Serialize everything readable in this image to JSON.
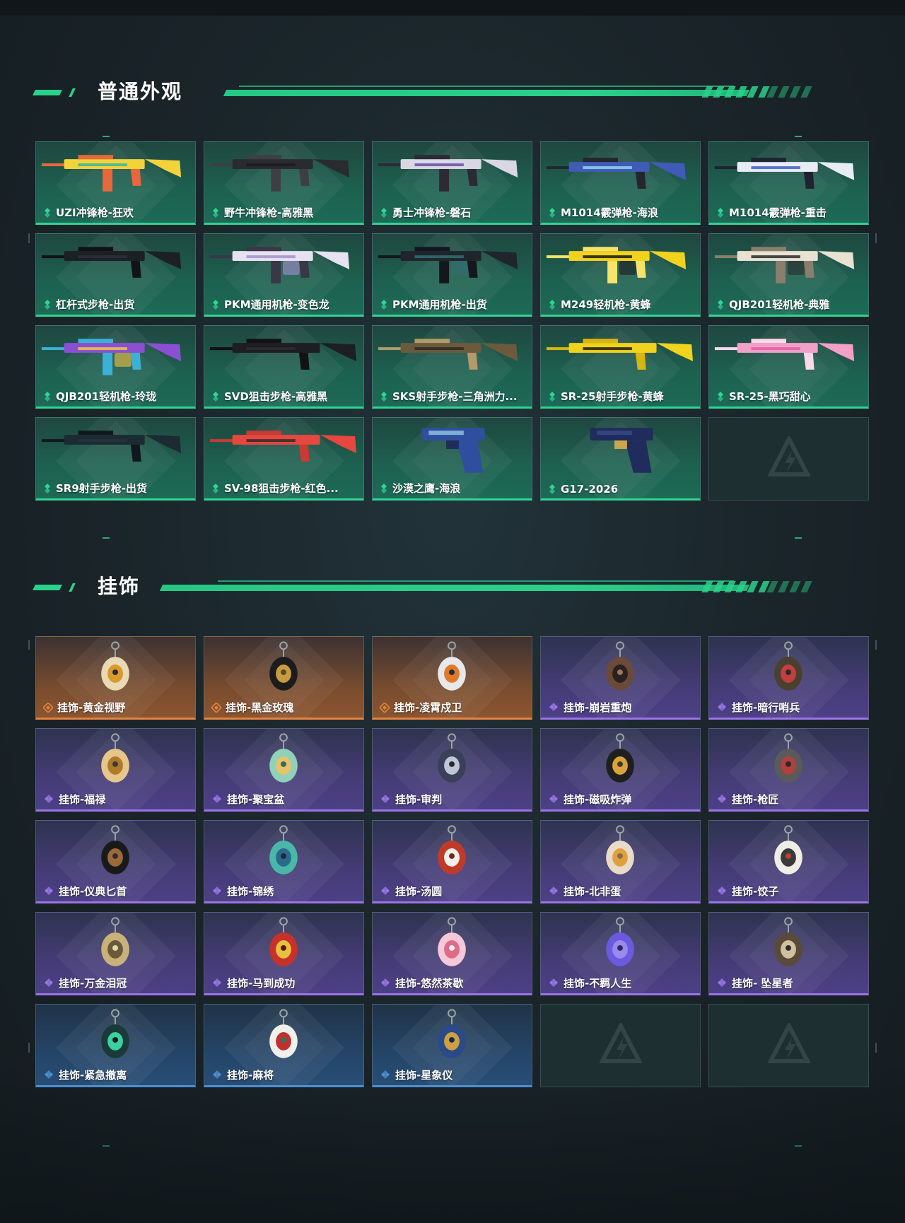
{
  "sections": [
    {
      "title": "普通外观",
      "rarity_color": "#2fd592",
      "items": [
        {
          "label": "UZI冲锋枪-狂欢",
          "kind": "smg",
          "colors": [
            "#f3d23a",
            "#39b6a2",
            "#e8683a"
          ]
        },
        {
          "label": "野牛冲锋枪-高雅黑",
          "kind": "smg",
          "colors": [
            "#2a2b2e",
            "#1b1c1e",
            "#3e3f43"
          ]
        },
        {
          "label": "勇士冲锋枪-磐石",
          "kind": "smg",
          "colors": [
            "#d9d7e4",
            "#6b4fa3",
            "#2c2a33"
          ]
        },
        {
          "label": "M1014霰弹枪-海浪",
          "kind": "shotgun",
          "colors": [
            "#3f5bb5",
            "#8fd5ef",
            "#23262d"
          ]
        },
        {
          "label": "M1014霰弹枪-重击",
          "kind": "shotgun",
          "colors": [
            "#e8ecf5",
            "#3e5fc2",
            "#1f2330"
          ]
        },
        {
          "label": "杠杆式步枪-出货",
          "kind": "rifle",
          "colors": [
            "#1c1f24",
            "#2b3038",
            "#111316"
          ]
        },
        {
          "label": "PKM通用机枪-变色龙",
          "kind": "lmg",
          "colors": [
            "#e6e2ef",
            "#a491d1",
            "#3a3747"
          ]
        },
        {
          "label": "PKM通用机枪-出货",
          "kind": "lmg",
          "colors": [
            "#20242b",
            "#2f6f74",
            "#14171b"
          ]
        },
        {
          "label": "M249轻机枪-黄蜂",
          "kind": "lmg",
          "colors": [
            "#f1d21d",
            "#1a1a1a",
            "#f6e36a"
          ]
        },
        {
          "label": "QJB201轻机枪-典雅",
          "kind": "lmg",
          "colors": [
            "#e9e2d3",
            "#2a2a2d",
            "#8a7f6c"
          ]
        },
        {
          "label": "QJB201轻机枪-玲珑",
          "kind": "lmg",
          "colors": [
            "#8b4fd3",
            "#f0c541",
            "#3bb1d8"
          ]
        },
        {
          "label": "SVD狙击步枪-高雅黑",
          "kind": "sniper",
          "colors": [
            "#1d1e21",
            "#2c2d31",
            "#111214"
          ]
        },
        {
          "label": "SKS射手步枪-三角洲力...",
          "kind": "rifle",
          "colors": [
            "#6b5a3b",
            "#2c2a25",
            "#b29b6a"
          ]
        },
        {
          "label": "SR-25射手步枪-黄蜂",
          "kind": "sniper",
          "colors": [
            "#f1d21d",
            "#1b1b1b",
            "#d9b50f"
          ]
        },
        {
          "label": "SR-25-黑巧甜心",
          "kind": "rifle",
          "colors": [
            "#f2a0c8",
            "#e35fa2",
            "#f9d9ea"
          ]
        },
        {
          "label": "SR9射手步枪-出货",
          "kind": "rifle",
          "colors": [
            "#1b2a33",
            "#24353f",
            "#10181d"
          ]
        },
        {
          "label": "SV-98狙击步枪-红色...",
          "kind": "sniper",
          "colors": [
            "#e6473e",
            "#2b2b2e",
            "#c83a32"
          ]
        },
        {
          "label": "沙漠之鹰-海浪",
          "kind": "pistol",
          "colors": [
            "#2f4f9e",
            "#9fd8f1",
            "#1e2d59"
          ]
        },
        {
          "label": "G17-2026",
          "kind": "pistol",
          "colors": [
            "#1f2c5c",
            "#3c4f8e",
            "#c9a74b"
          ]
        },
        {
          "label": "",
          "kind": "empty",
          "colors": []
        }
      ]
    },
    {
      "title": "挂饰",
      "items": [
        {
          "label": "挂饰-黄金视野",
          "rarity": "orange",
          "colors": [
            "#e9d9b4",
            "#d99a2a",
            "#2a2a2a"
          ]
        },
        {
          "label": "挂饰-黑金玫瑰",
          "rarity": "orange",
          "colors": [
            "#1c1c1c",
            "#c89b3c",
            "#5a4a2a"
          ]
        },
        {
          "label": "挂饰-凌霄戍卫",
          "rarity": "orange",
          "colors": [
            "#e8e8ea",
            "#e07a2a",
            "#2b2b2b"
          ]
        },
        {
          "label": "挂饰-崩岩重炮",
          "rarity": "purple",
          "colors": [
            "#6b4a3a",
            "#2a2020",
            "#9a7a5a"
          ]
        },
        {
          "label": "挂饰-暗行哨兵",
          "rarity": "purple",
          "colors": [
            "#4a4030",
            "#c04040",
            "#2a2a2a"
          ]
        },
        {
          "label": "挂饰-福禄",
          "rarity": "purple",
          "colors": [
            "#e6c68a",
            "#b07a2a",
            "#3a3a3a"
          ]
        },
        {
          "label": "挂饰-聚宝盆",
          "rarity": "purple",
          "colors": [
            "#8fd2b9",
            "#e6c26a",
            "#3a6a5a"
          ]
        },
        {
          "label": "挂饰-审判",
          "rarity": "purple",
          "colors": [
            "#3a3f5a",
            "#c0c6d8",
            "#2a2a2a"
          ]
        },
        {
          "label": "挂饰-磁吸炸弹",
          "rarity": "purple",
          "colors": [
            "#1f1f1f",
            "#d9a43a",
            "#3a3a3a"
          ]
        },
        {
          "label": "挂饰-枪匠",
          "rarity": "purple",
          "colors": [
            "#5a5a5a",
            "#b04040",
            "#2a2a2a"
          ]
        },
        {
          "label": "挂饰-仪典匕首",
          "rarity": "purple",
          "colors": [
            "#1a1a1a",
            "#9a6a3a",
            "#3a2a2a"
          ]
        },
        {
          "label": "挂饰-锦绣",
          "rarity": "purple",
          "colors": [
            "#4ab8a8",
            "#2a6a8a",
            "#1a2a3a"
          ]
        },
        {
          "label": "挂饰-汤圆",
          "rarity": "purple",
          "colors": [
            "#c03a2a",
            "#f2efe8",
            "#6a2a20"
          ]
        },
        {
          "label": "挂饰-北非蛋",
          "rarity": "purple",
          "colors": [
            "#e8dcc8",
            "#e0a040",
            "#8a6a4a"
          ]
        },
        {
          "label": "挂饰-饺子",
          "rarity": "purple",
          "colors": [
            "#f0ede6",
            "#3a3a3a",
            "#c04030"
          ]
        },
        {
          "label": "挂饰-万金泪冠",
          "rarity": "purple",
          "colors": [
            "#c8b27a",
            "#6a5a3a",
            "#e8d8a8"
          ]
        },
        {
          "label": "挂饰-马到成功",
          "rarity": "purple",
          "colors": [
            "#c8302a",
            "#e8c040",
            "#5a1a1a"
          ]
        },
        {
          "label": "挂饰-悠然茶歇",
          "rarity": "purple",
          "colors": [
            "#f6c8d8",
            "#e06a8a",
            "#f8f0f2"
          ]
        },
        {
          "label": "挂饰-不羁人生",
          "rarity": "purple",
          "colors": [
            "#6a5ae0",
            "#9a8af0",
            "#2a2a5a"
          ]
        },
        {
          "label": "挂饰- 坠星者",
          "rarity": "purple",
          "colors": [
            "#5a4a3a",
            "#d0c0a0",
            "#2a2a2a"
          ]
        },
        {
          "label": "挂饰-紧急撤离",
          "rarity": "blue",
          "colors": [
            "#1a3a3a",
            "#3ad0a0",
            "#0a1a1a"
          ]
        },
        {
          "label": "挂饰-麻将",
          "rarity": "blue",
          "colors": [
            "#f0f0ea",
            "#c03030",
            "#2a7a5a"
          ]
        },
        {
          "label": "挂饰-星象仪",
          "rarity": "blue",
          "colors": [
            "#2a4a8a",
            "#d0a040",
            "#1a2a4a"
          ]
        },
        {
          "label": "",
          "rarity": "empty",
          "colors": []
        },
        {
          "label": "",
          "rarity": "empty",
          "colors": []
        }
      ]
    }
  ],
  "colors": {
    "accent_green": "#2ad18b",
    "rarity_orange": "#e3843f",
    "rarity_purple": "#9b74e6",
    "rarity_blue": "#4b8fd6",
    "rarity_green": "#2fd592"
  }
}
